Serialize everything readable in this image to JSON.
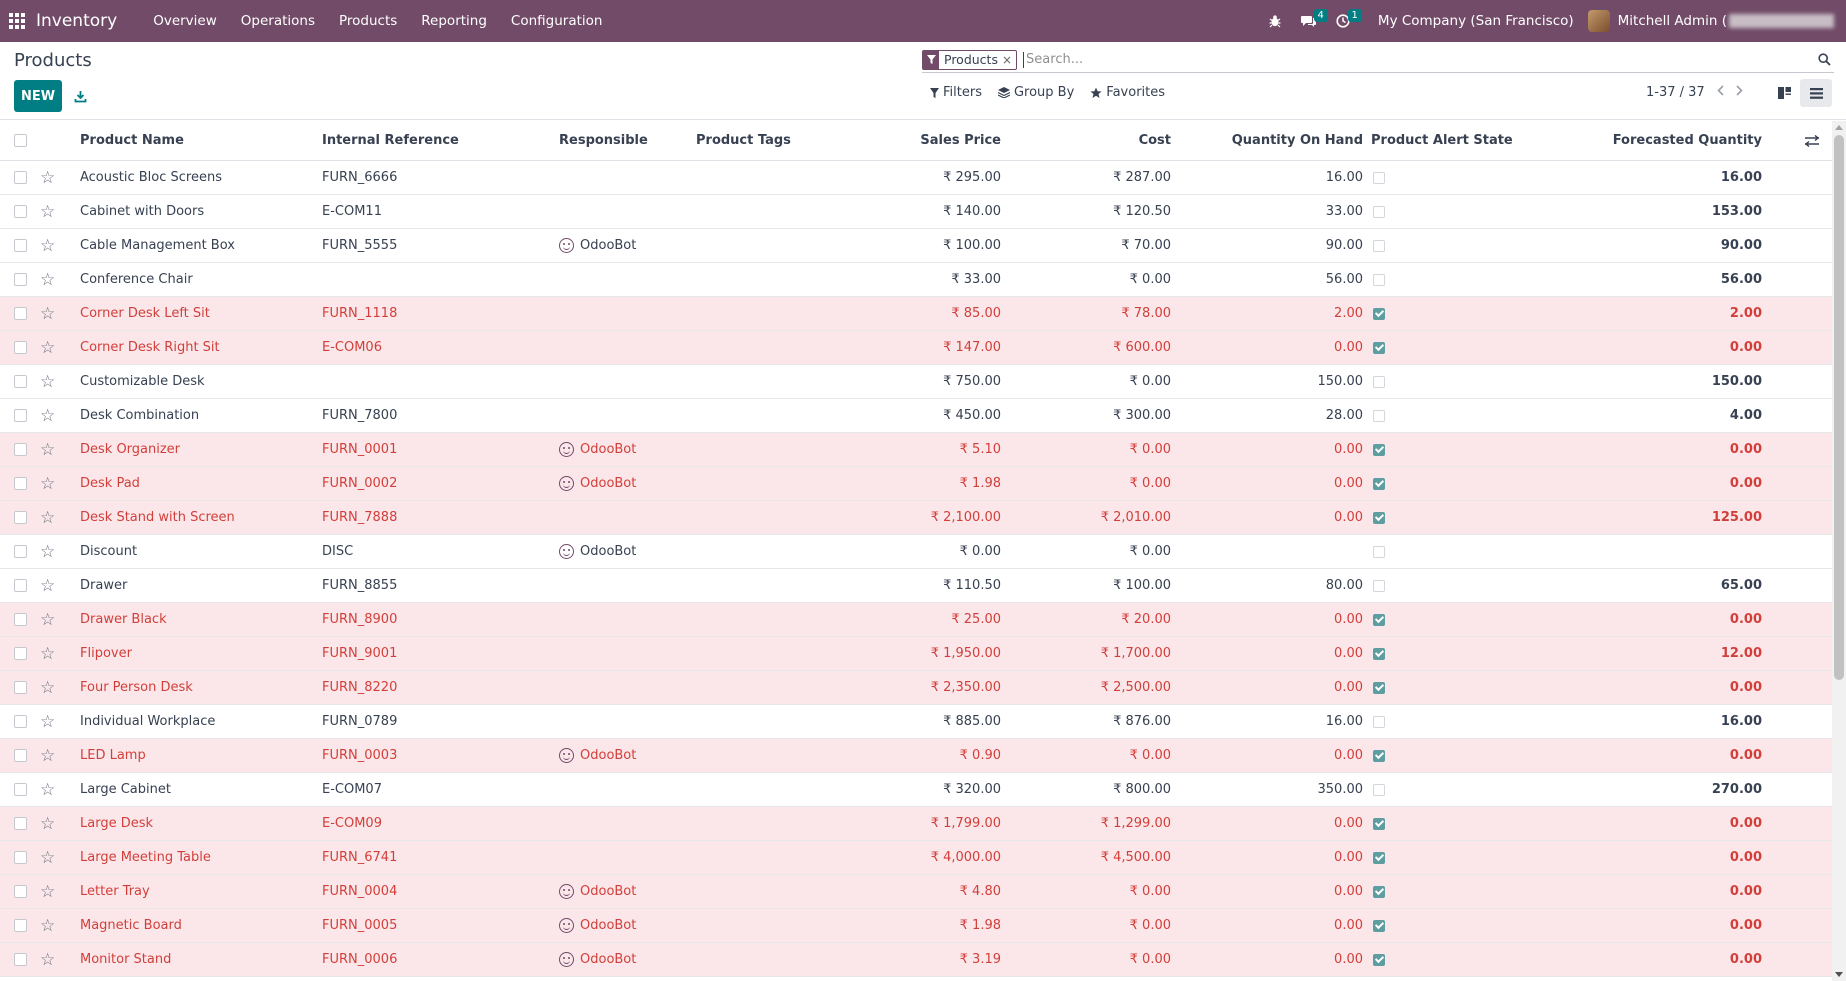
{
  "navbar": {
    "app_name": "Inventory",
    "menu": [
      "Overview",
      "Operations",
      "Products",
      "Reporting",
      "Configuration"
    ],
    "messages_count": "4",
    "activities_count": "1",
    "company": "My Company (San Francisco)",
    "user": "Mitchell Admin ("
  },
  "control": {
    "title": "Products",
    "new_label": "NEW",
    "facet_label": "Products",
    "facet_close": "×",
    "search_placeholder": "Search...",
    "filters_label": "Filters",
    "groupby_label": "Group By",
    "favorites_label": "Favorites",
    "pager": "1-37 / 37"
  },
  "colors": {
    "brand": "#714b67",
    "primary_button": "#017e84",
    "warning_row_bg": "#fbe7ea",
    "warning_text": "#d23f3a"
  },
  "table": {
    "columns": {
      "name": "Product Name",
      "ref": "Internal Reference",
      "responsible": "Responsible",
      "tags": "Product Tags",
      "price": "Sales Price",
      "cost": "Cost",
      "qty": "Quantity On Hand",
      "alert": "Product Alert State",
      "forecast": "Forecasted Quantity"
    },
    "rows": [
      {
        "name": "Acoustic Bloc Screens",
        "ref": "FURN_6666",
        "resp": "",
        "price": "₹ 295.00",
        "cost": "₹ 287.00",
        "qty": "16.00",
        "alert": false,
        "forecast": "16.00"
      },
      {
        "name": "Cabinet with Doors",
        "ref": "E-COM11",
        "resp": "",
        "price": "₹ 140.00",
        "cost": "₹ 120.50",
        "qty": "33.00",
        "alert": false,
        "forecast": "153.00"
      },
      {
        "name": "Cable Management Box",
        "ref": "FURN_5555",
        "resp": "OdooBot",
        "price": "₹ 100.00",
        "cost": "₹ 70.00",
        "qty": "90.00",
        "alert": false,
        "forecast": "90.00"
      },
      {
        "name": "Conference Chair",
        "ref": "",
        "resp": "",
        "price": "₹ 33.00",
        "cost": "₹ 0.00",
        "qty": "56.00",
        "alert": false,
        "forecast": "56.00"
      },
      {
        "name": "Corner Desk Left Sit",
        "ref": "FURN_1118",
        "resp": "",
        "price": "₹ 85.00",
        "cost": "₹ 78.00",
        "qty": "2.00",
        "alert": true,
        "forecast": "2.00"
      },
      {
        "name": "Corner Desk Right Sit",
        "ref": "E-COM06",
        "resp": "",
        "price": "₹ 147.00",
        "cost": "₹ 600.00",
        "qty": "0.00",
        "alert": true,
        "forecast": "0.00"
      },
      {
        "name": "Customizable Desk",
        "ref": "",
        "resp": "",
        "price": "₹ 750.00",
        "cost": "₹ 0.00",
        "qty": "150.00",
        "alert": false,
        "forecast": "150.00"
      },
      {
        "name": "Desk Combination",
        "ref": "FURN_7800",
        "resp": "",
        "price": "₹ 450.00",
        "cost": "₹ 300.00",
        "qty": "28.00",
        "alert": false,
        "forecast": "4.00"
      },
      {
        "name": "Desk Organizer",
        "ref": "FURN_0001",
        "resp": "OdooBot",
        "price": "₹ 5.10",
        "cost": "₹ 0.00",
        "qty": "0.00",
        "alert": true,
        "forecast": "0.00"
      },
      {
        "name": "Desk Pad",
        "ref": "FURN_0002",
        "resp": "OdooBot",
        "price": "₹ 1.98",
        "cost": "₹ 0.00",
        "qty": "0.00",
        "alert": true,
        "forecast": "0.00"
      },
      {
        "name": "Desk Stand with Screen",
        "ref": "FURN_7888",
        "resp": "",
        "price": "₹ 2,100.00",
        "cost": "₹ 2,010.00",
        "qty": "0.00",
        "alert": true,
        "forecast": "125.00"
      },
      {
        "name": "Discount",
        "ref": "DISC",
        "resp": "OdooBot",
        "price": "₹ 0.00",
        "cost": "₹ 0.00",
        "qty": "",
        "alert": false,
        "forecast": ""
      },
      {
        "name": "Drawer",
        "ref": "FURN_8855",
        "resp": "",
        "price": "₹ 110.50",
        "cost": "₹ 100.00",
        "qty": "80.00",
        "alert": false,
        "forecast": "65.00"
      },
      {
        "name": "Drawer Black",
        "ref": "FURN_8900",
        "resp": "",
        "price": "₹ 25.00",
        "cost": "₹ 20.00",
        "qty": "0.00",
        "alert": true,
        "forecast": "0.00"
      },
      {
        "name": "Flipover",
        "ref": "FURN_9001",
        "resp": "",
        "price": "₹ 1,950.00",
        "cost": "₹ 1,700.00",
        "qty": "0.00",
        "alert": true,
        "forecast": "12.00"
      },
      {
        "name": "Four Person Desk",
        "ref": "FURN_8220",
        "resp": "",
        "price": "₹ 2,350.00",
        "cost": "₹ 2,500.00",
        "qty": "0.00",
        "alert": true,
        "forecast": "0.00"
      },
      {
        "name": "Individual Workplace",
        "ref": "FURN_0789",
        "resp": "",
        "price": "₹ 885.00",
        "cost": "₹ 876.00",
        "qty": "16.00",
        "alert": false,
        "forecast": "16.00"
      },
      {
        "name": "LED Lamp",
        "ref": "FURN_0003",
        "resp": "OdooBot",
        "price": "₹ 0.90",
        "cost": "₹ 0.00",
        "qty": "0.00",
        "alert": true,
        "forecast": "0.00"
      },
      {
        "name": "Large Cabinet",
        "ref": "E-COM07",
        "resp": "",
        "price": "₹ 320.00",
        "cost": "₹ 800.00",
        "qty": "350.00",
        "alert": false,
        "forecast": "270.00"
      },
      {
        "name": "Large Desk",
        "ref": "E-COM09",
        "resp": "",
        "price": "₹ 1,799.00",
        "cost": "₹ 1,299.00",
        "qty": "0.00",
        "alert": true,
        "forecast": "0.00"
      },
      {
        "name": "Large Meeting Table",
        "ref": "FURN_6741",
        "resp": "",
        "price": "₹ 4,000.00",
        "cost": "₹ 4,500.00",
        "qty": "0.00",
        "alert": true,
        "forecast": "0.00"
      },
      {
        "name": "Letter Tray",
        "ref": "FURN_0004",
        "resp": "OdooBot",
        "price": "₹ 4.80",
        "cost": "₹ 0.00",
        "qty": "0.00",
        "alert": true,
        "forecast": "0.00"
      },
      {
        "name": "Magnetic Board",
        "ref": "FURN_0005",
        "resp": "OdooBot",
        "price": "₹ 1.98",
        "cost": "₹ 0.00",
        "qty": "0.00",
        "alert": true,
        "forecast": "0.00"
      },
      {
        "name": "Monitor Stand",
        "ref": "FURN_0006",
        "resp": "OdooBot",
        "price": "₹ 3.19",
        "cost": "₹ 0.00",
        "qty": "0.00",
        "alert": true,
        "forecast": "0.00"
      }
    ]
  }
}
